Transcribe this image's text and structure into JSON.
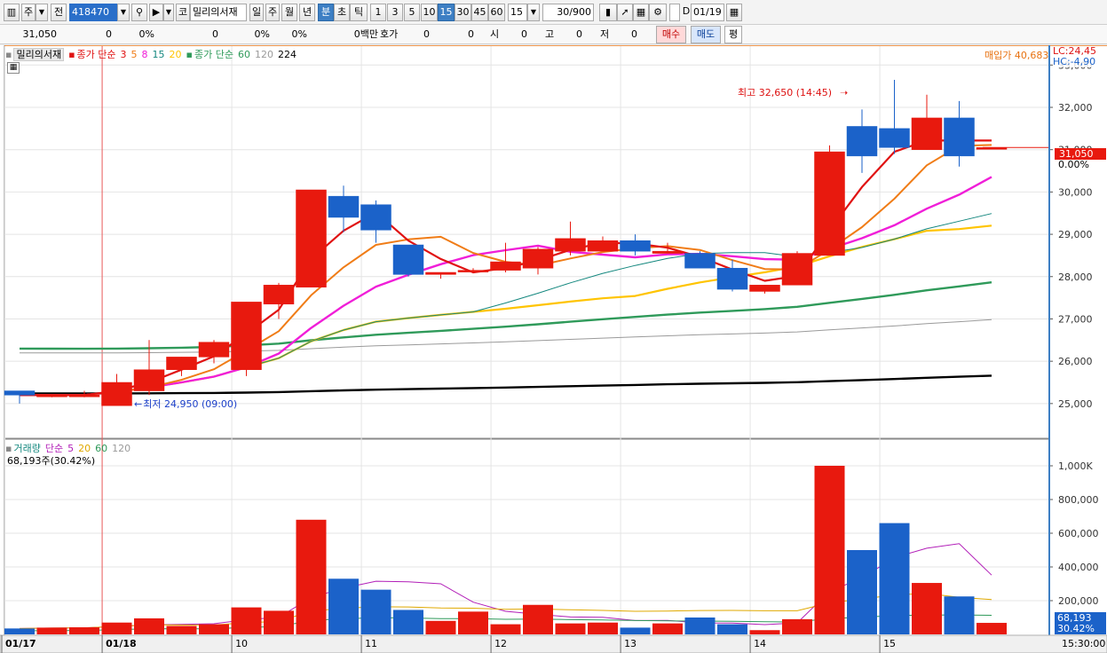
{
  "toolbar": {
    "chart_kind": "주",
    "prev_label": "전",
    "stock_code": "418470",
    "market_label": "코",
    "stock_name": "밀리의서재",
    "periods": [
      "일",
      "주",
      "월",
      "년",
      "분",
      "초",
      "틱"
    ],
    "selected_period": "분",
    "intervals": [
      "1",
      "3",
      "5",
      "10",
      "15",
      "30",
      "45",
      "60"
    ],
    "selected_interval": "15",
    "interval_value": "15",
    "count_value": "30",
    "count_max": "/900",
    "d_label": "D",
    "date_value": "01/19"
  },
  "quote": {
    "price": "31,050",
    "change": "0",
    "change_pct": "0%",
    "volume": "0",
    "volume_pct": "0%",
    "amount": "0백만",
    "hoga_label": "호가",
    "hoga": "0",
    "hoga_val": "0",
    "open_label": "시",
    "open": "0",
    "high_label": "고",
    "high": "0",
    "low_label": "저",
    "low": "0",
    "buy_label": "매수",
    "sell_label": "매도",
    "avg_label": "평"
  },
  "price_legend": {
    "name": "밀리의서재",
    "ma_short_label": "종가 단순",
    "ma_short_periods": [
      "3",
      "5",
      "8",
      "15",
      "20"
    ],
    "ma_long_label": "종가 단순",
    "ma_long_periods": [
      "60",
      "120",
      "224"
    ],
    "buy_price": "매입가 40,683",
    "lc": "LC:24,45",
    "hc": "HC:-4,90"
  },
  "volume_legend": {
    "title": "거래량",
    "ma_label": "단순",
    "ma_periods": [
      "5",
      "20",
      "60",
      "120"
    ],
    "current": "68,193주(30.42%)"
  },
  "annotations": {
    "high_text": "최고 32,650 (14:45)",
    "low_text": "최저 24,950 (09:00)",
    "last_price_tag": "31,050",
    "last_pct_tag": "0.00%",
    "vol_tag": "68,193",
    "vol_pct_tag": "30.42%"
  },
  "colors": {
    "up": "#e8190e",
    "down": "#1b62c9",
    "ma3": "#e01212",
    "ma5": "#f07c16",
    "ma8": "#f01ed8",
    "ma15": "#13877e",
    "ma20": "#ffc400",
    "ma60": "#2f9a5a",
    "ma120": "#9a9a9a",
    "ma224": "#000000"
  },
  "chart_data": {
    "type": "candlestick",
    "x_labels": [
      "01/17",
      "01/18",
      "10",
      "11",
      "12",
      "13",
      "14",
      "15"
    ],
    "time_label": "15:30:00",
    "price_ticks": [
      "33,000",
      "32,000",
      "31,000",
      "30,000",
      "29,000",
      "28,000",
      "27,000",
      "26,000",
      "25,000"
    ],
    "price_range": [
      24200,
      33300
    ],
    "volume_ticks": [
      "1,000K",
      "800,000",
      "600,000",
      "400,000",
      "200,000"
    ],
    "volume_range": [
      0,
      1100000
    ],
    "candles": [
      {
        "o": 25300,
        "h": 25300,
        "l": 25000,
        "c": 25200,
        "v": 35000
      },
      {
        "o": 25200,
        "h": 25200,
        "l": 25150,
        "c": 25200,
        "v": 40000
      },
      {
        "o": 25200,
        "h": 25300,
        "l": 25150,
        "c": 25200,
        "v": 42000
      },
      {
        "o": 24950,
        "h": 25700,
        "l": 24950,
        "c": 25500,
        "v": 70000
      },
      {
        "o": 25300,
        "h": 26500,
        "l": 25200,
        "c": 25800,
        "v": 95000
      },
      {
        "o": 25800,
        "h": 26100,
        "l": 25650,
        "c": 26100,
        "v": 50000
      },
      {
        "o": 26100,
        "h": 26500,
        "l": 25950,
        "c": 26450,
        "v": 60000
      },
      {
        "o": 25800,
        "h": 27400,
        "l": 25650,
        "c": 27400,
        "v": 160000
      },
      {
        "o": 27350,
        "h": 27850,
        "l": 27000,
        "c": 27800,
        "v": 140000
      },
      {
        "o": 27750,
        "h": 30050,
        "l": 27750,
        "c": 30050,
        "v": 680000
      },
      {
        "o": 29900,
        "h": 30150,
        "l": 29050,
        "c": 29400,
        "v": 330000
      },
      {
        "o": 29700,
        "h": 29800,
        "l": 28800,
        "c": 29100,
        "v": 265000
      },
      {
        "o": 28750,
        "h": 28750,
        "l": 28000,
        "c": 28050,
        "v": 145000
      },
      {
        "o": 28050,
        "h": 28100,
        "l": 27950,
        "c": 28100,
        "v": 80000
      },
      {
        "o": 28150,
        "h": 28200,
        "l": 28100,
        "c": 28150,
        "v": 135000
      },
      {
        "o": 28150,
        "h": 28800,
        "l": 28100,
        "c": 28350,
        "v": 60000
      },
      {
        "o": 28200,
        "h": 28700,
        "l": 28050,
        "c": 28650,
        "v": 175000
      },
      {
        "o": 28600,
        "h": 29300,
        "l": 28500,
        "c": 28900,
        "v": 65000
      },
      {
        "o": 28600,
        "h": 28950,
        "l": 28600,
        "c": 28850,
        "v": 70000
      },
      {
        "o": 28850,
        "h": 29000,
        "l": 28500,
        "c": 28600,
        "v": 40000
      },
      {
        "o": 28550,
        "h": 28800,
        "l": 28550,
        "c": 28600,
        "v": 65000
      },
      {
        "o": 28550,
        "h": 28600,
        "l": 28200,
        "c": 28200,
        "v": 100000
      },
      {
        "o": 28200,
        "h": 28400,
        "l": 27650,
        "c": 27700,
        "v": 60000
      },
      {
        "o": 27650,
        "h": 27800,
        "l": 27600,
        "c": 27800,
        "v": 25000
      },
      {
        "o": 27800,
        "h": 28600,
        "l": 27800,
        "c": 28550,
        "v": 90000
      },
      {
        "o": 28500,
        "h": 31100,
        "l": 28500,
        "c": 30950,
        "v": 1000000
      },
      {
        "o": 31550,
        "h": 31950,
        "l": 30450,
        "c": 30850,
        "v": 500000
      },
      {
        "o": 31500,
        "h": 32650,
        "l": 30900,
        "c": 31050,
        "v": 660000
      },
      {
        "o": 31000,
        "h": 32300,
        "l": 31000,
        "c": 31750,
        "v": 305000
      },
      {
        "o": 31750,
        "h": 32150,
        "l": 30600,
        "c": 30850,
        "v": 225000
      },
      {
        "o": 31050,
        "h": 31050,
        "l": 31050,
        "c": 31050,
        "v": 68193
      }
    ]
  }
}
